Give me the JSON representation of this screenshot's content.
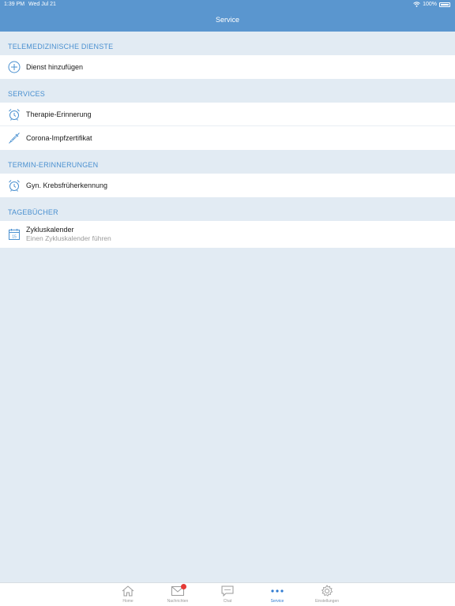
{
  "status_bar": {
    "time": "1:39 PM",
    "date": "Wed Jul 21",
    "battery": "100%"
  },
  "nav": {
    "title": "Service"
  },
  "sections": [
    {
      "header": "TELEMEDIZINISCHE DIENSTE",
      "items": [
        {
          "label": "Dienst hinzufügen",
          "icon": "plus-circle-icon"
        }
      ]
    },
    {
      "header": "SERVICES",
      "items": [
        {
          "label": "Therapie-Erinnerung",
          "icon": "alarm-clock-icon"
        },
        {
          "label": "Corona-Impfzertifikat",
          "icon": "syringe-icon"
        }
      ]
    },
    {
      "header": "TERMIN-ERINNERUNGEN",
      "items": [
        {
          "label": "Gyn. Krebsfrüherkennung",
          "icon": "alarm-clock-icon"
        }
      ]
    },
    {
      "header": "TAGEBÜCHER",
      "items": [
        {
          "label": "Zykluskalender",
          "sublabel": "Einen Zykluskalender führen",
          "icon": "calendar-icon",
          "icon_text": "15"
        }
      ]
    }
  ],
  "tabbar": {
    "tabs": [
      {
        "label": "Home",
        "icon": "home-icon",
        "active": false
      },
      {
        "label": "Nachrichten",
        "icon": "envelope-icon",
        "active": false
      },
      {
        "label": "Chat",
        "icon": "chat-bubble-icon",
        "active": false
      },
      {
        "label": "Service",
        "icon": "more-dots-icon",
        "active": true
      },
      {
        "label": "Einstellungen",
        "icon": "gear-icon",
        "active": false
      }
    ]
  },
  "colors": {
    "accent": "#4a90d0",
    "nav_bg": "#5a96cf",
    "background": "#e2ebf3",
    "badge": "#e53935"
  }
}
